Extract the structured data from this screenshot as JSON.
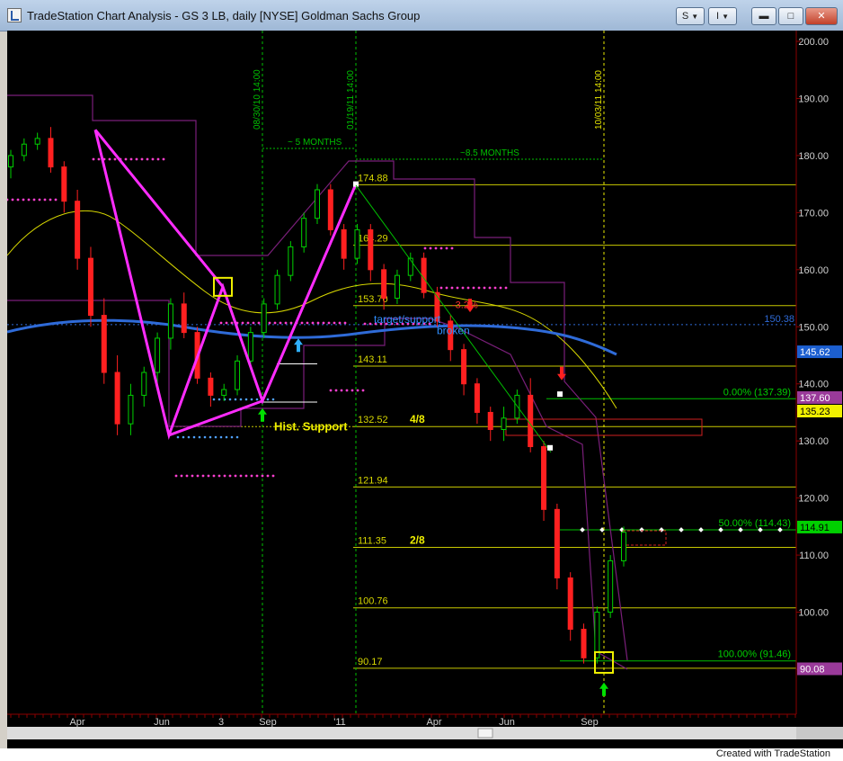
{
  "window": {
    "title": "TradeStation Chart Analysis - GS 3 LB, daily [NYSE] Goldman Sachs Group",
    "buttons": {
      "s_label": "S",
      "i_label": "I"
    },
    "credit": "Created with TradeStation"
  },
  "chart_data": {
    "type": "candlestick",
    "symbol": "GS",
    "y_axis": {
      "range": [
        86,
        202
      ],
      "ticks": [
        90,
        100,
        110,
        120,
        130,
        140,
        150,
        160,
        170,
        180,
        190,
        200
      ],
      "tick_labels": [
        "90.00",
        "100.00",
        "110.00",
        "120.00",
        "130.00",
        "140.00",
        "150.00",
        "160.00",
        "170.00",
        "180.00",
        "190.00",
        "200.00"
      ]
    },
    "x_axis": {
      "tick_labels": [
        "Apr",
        "Jun",
        "3",
        "Sep",
        "'11",
        "Apr",
        "Jun",
        "Sep"
      ]
    },
    "price_tags": [
      {
        "value": 150.38,
        "label": "150.38",
        "color": "#2f6bd8",
        "style": "text"
      },
      {
        "value": 145.62,
        "label": "145.62",
        "color": "#1c5fd0",
        "style": "box"
      },
      {
        "value": 137.6,
        "label": "137.60",
        "color": "#9a3a9a",
        "style": "box"
      },
      {
        "value": 135.23,
        "label": "135.23",
        "color": "#f0f000",
        "style": "box"
      },
      {
        "value": 114.91,
        "label": "114.91",
        "color": "#00d000",
        "style": "box"
      },
      {
        "value": 90.08,
        "label": "90.08",
        "color": "#9a3a9a",
        "style": "box"
      }
    ],
    "levels": [
      {
        "value": 174.88,
        "label": "174.88"
      },
      {
        "value": 164.29,
        "label": "164.29"
      },
      {
        "value": 153.7,
        "label": "153.70"
      },
      {
        "value": 143.11,
        "label": "143.11"
      },
      {
        "value": 132.52,
        "label": "132.52",
        "note": "4/8"
      },
      {
        "value": 121.94,
        "label": "121.94"
      },
      {
        "value": 111.35,
        "label": "111.35",
        "note": "2/8"
      },
      {
        "value": 100.76,
        "label": "100.76"
      },
      {
        "value": 90.17,
        "label": "90.17"
      }
    ],
    "fib_levels": [
      {
        "value": 137.39,
        "label": "0.00% (137.39)"
      },
      {
        "value": 114.43,
        "label": "50.00% (114.43)"
      },
      {
        "value": 91.46,
        "label": "100.00% (91.46)"
      }
    ],
    "vertical_markers": [
      {
        "label": "08/30/10 14:00"
      },
      {
        "label": "01/19/11 14:00"
      },
      {
        "label": "10/03/11 14:00"
      }
    ],
    "annotations": {
      "five_months": "~ 5 MONTHS",
      "eight_months": "~8.5 MONTHS",
      "hist_support": "Hist. Support",
      "target_support": "target/support",
      "broken": "broken",
      "pct": "-3.2%"
    },
    "pattern_points": [
      {
        "date": "Apr-2010",
        "value": 184.5
      },
      {
        "date": "Jun-2010",
        "value": 131.0
      },
      {
        "date": "Jul-2010",
        "value": 157.0
      },
      {
        "date": "Aug-2010",
        "value": 137.0
      },
      {
        "date": "Jan-2011",
        "value": 175.0
      }
    ],
    "series": [
      {
        "name": "candles",
        "values": [
          [
            178,
            181,
            176,
            180
          ],
          [
            180,
            183,
            179,
            182
          ],
          [
            182,
            184,
            181,
            183
          ],
          [
            183,
            185,
            177,
            178
          ],
          [
            178,
            179,
            170,
            172
          ],
          [
            172,
            174,
            160,
            162
          ],
          [
            162,
            164,
            150,
            152
          ],
          [
            152,
            155,
            140,
            142
          ],
          [
            142,
            145,
            131,
            133
          ],
          [
            133,
            140,
            131,
            138
          ],
          [
            138,
            143,
            136,
            142
          ],
          [
            142,
            149,
            140,
            148
          ],
          [
            148,
            155,
            146,
            154
          ],
          [
            154,
            156,
            148,
            149
          ],
          [
            149,
            150,
            140,
            141
          ],
          [
            141,
            142,
            136,
            138
          ],
          [
            138,
            140,
            137,
            139
          ],
          [
            139,
            145,
            138,
            144
          ],
          [
            144,
            150,
            143,
            149
          ],
          [
            149,
            155,
            148,
            154
          ],
          [
            154,
            160,
            153,
            159
          ],
          [
            159,
            165,
            158,
            164
          ],
          [
            164,
            170,
            163,
            169
          ],
          [
            169,
            175,
            168,
            174
          ],
          [
            174,
            175,
            166,
            167
          ],
          [
            167,
            168,
            160,
            162
          ],
          [
            162,
            168,
            161,
            167
          ],
          [
            167,
            168,
            158,
            160
          ],
          [
            160,
            161,
            153,
            155
          ],
          [
            155,
            160,
            154,
            159
          ],
          [
            159,
            163,
            158,
            162
          ],
          [
            162,
            163,
            155,
            156
          ],
          [
            156,
            157,
            150,
            151
          ],
          [
            151,
            152,
            144,
            146
          ],
          [
            146,
            147,
            138,
            140
          ],
          [
            140,
            141,
            133,
            135
          ],
          [
            135,
            136,
            130,
            132
          ],
          [
            132,
            136,
            130,
            134
          ],
          [
            134,
            139,
            133,
            138
          ],
          [
            138,
            141,
            128,
            129
          ],
          [
            129,
            130,
            116,
            118
          ],
          [
            118,
            119,
            104,
            106
          ],
          [
            106,
            107,
            95,
            97
          ],
          [
            97,
            98,
            91,
            92
          ],
          [
            92,
            101,
            91,
            100
          ],
          [
            100,
            110,
            99,
            109
          ],
          [
            109,
            115,
            108,
            114
          ]
        ]
      }
    ],
    "grid": false,
    "legend": "none"
  }
}
